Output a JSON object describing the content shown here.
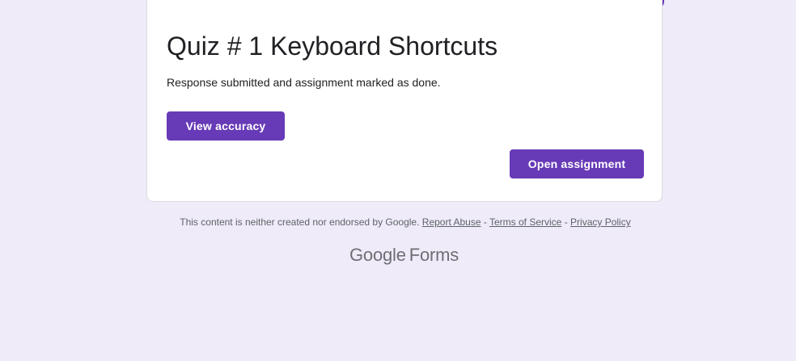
{
  "form": {
    "title": "Quiz # 1 Keyboard Shortcuts",
    "confirmation_message": "Response submitted and assignment marked as done.",
    "view_accuracy_label": "View accuracy",
    "open_assignment_label": "Open assignment"
  },
  "footer": {
    "disclaimer": "This content is neither created nor endorsed by Google.",
    "separator": "-",
    "report_abuse": "Report Abuse",
    "terms": "Terms of Service",
    "privacy": "Privacy Policy"
  },
  "brand": {
    "google": "Google",
    "product": "Forms"
  },
  "colors": {
    "accent": "#673ab7",
    "page_background": "#efebf8"
  }
}
